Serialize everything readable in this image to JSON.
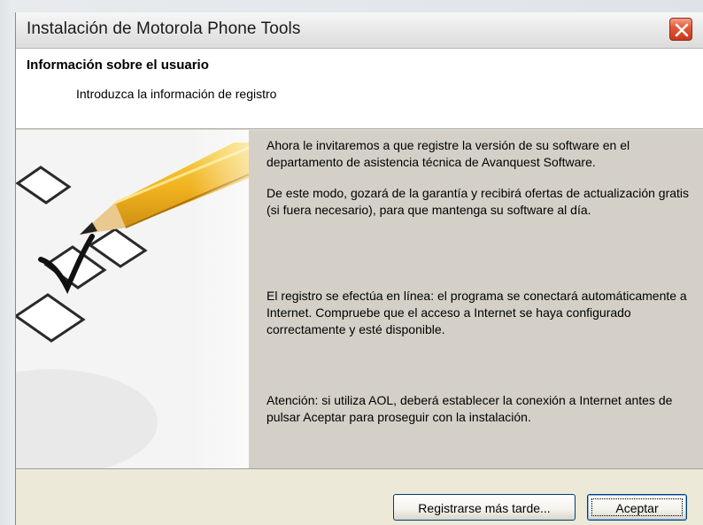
{
  "window": {
    "title": "Instalación de Motorola Phone Tools"
  },
  "header": {
    "title": "Información sobre el usuario",
    "subtitle": "Introduzca la información de registro"
  },
  "content": {
    "paragraphs": [
      "Ahora le invitaremos a que registre la versión de su software en el departamento de asistencia técnica de Avanquest Software.",
      "De este modo, gozará de la garantía y recibirá ofertas de actualización gratis (si fuera necesario), para que mantenga su software al día.",
      "El registro se efectúa en línea: el programa se conectará automáticamente a Internet. Compruebe que el acceso a Internet se haya configurado correctamente y esté disponible.",
      "Atención: si utiliza AOL, deberá establecer la conexión a Internet antes de pulsar Aceptar para proseguir con la instalación."
    ]
  },
  "buttons": {
    "register_later": "Registrarse más tarde...",
    "accept": "Aceptar"
  },
  "icons": {
    "close": "close-icon",
    "illustration": "pencil-checklist-illustration"
  },
  "colors": {
    "dialog_bg": "#ece9d8",
    "panel_bg": "#d4d0c8",
    "close_red": "#d9482a",
    "pencil_yellow": "#f2c230"
  }
}
